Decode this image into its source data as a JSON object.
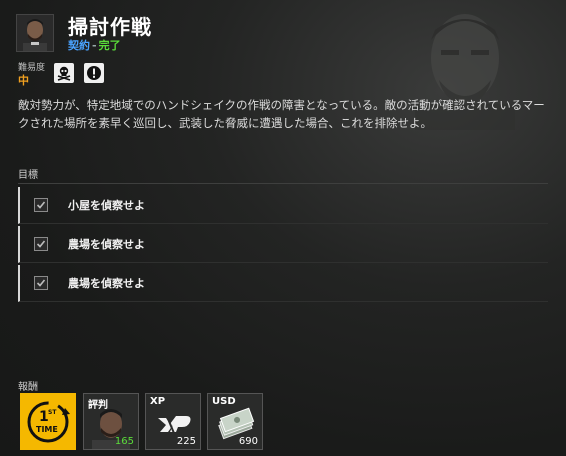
{
  "header": {
    "title": "掃討作戦",
    "type": "契約",
    "separator": "-",
    "status": "完了"
  },
  "difficulty": {
    "label": "難易度",
    "value": "中",
    "badges": [
      "skull-crossbones-icon",
      "alert-circle-icon"
    ]
  },
  "description": "敵対勢力が、特定地域でのハンドシェイクの作戦の障害となっている。敵の活動が確認されているマークされた場所を素早く巡回し、武装した脅威に遭遇した場合、これを排除せよ。",
  "objectives": {
    "label": "目標",
    "items": [
      {
        "text": "小屋を偵察せよ",
        "checked": true
      },
      {
        "text": "農場を偵察せよ",
        "checked": true
      },
      {
        "text": "農場を偵察せよ",
        "checked": true
      }
    ]
  },
  "rewards": {
    "label": "報酬",
    "items": [
      {
        "type": "first-time",
        "label": "",
        "icon": "first-time-badge-icon",
        "value": ""
      },
      {
        "type": "reputation",
        "label": "評判",
        "icon": "operator-portrait-icon",
        "value": "165"
      },
      {
        "type": "xp",
        "label": "XP",
        "icon": "xp-logo-icon",
        "value": "225"
      },
      {
        "type": "usd",
        "label": "USD",
        "icon": "cash-stack-icon",
        "value": "690"
      }
    ]
  },
  "colors": {
    "contract": "#4aa3ff",
    "status": "#5bdc3a",
    "difficulty": "#f0a020",
    "first_time_tile": "#f5b800",
    "reputation_value": "#5bdc3a"
  }
}
